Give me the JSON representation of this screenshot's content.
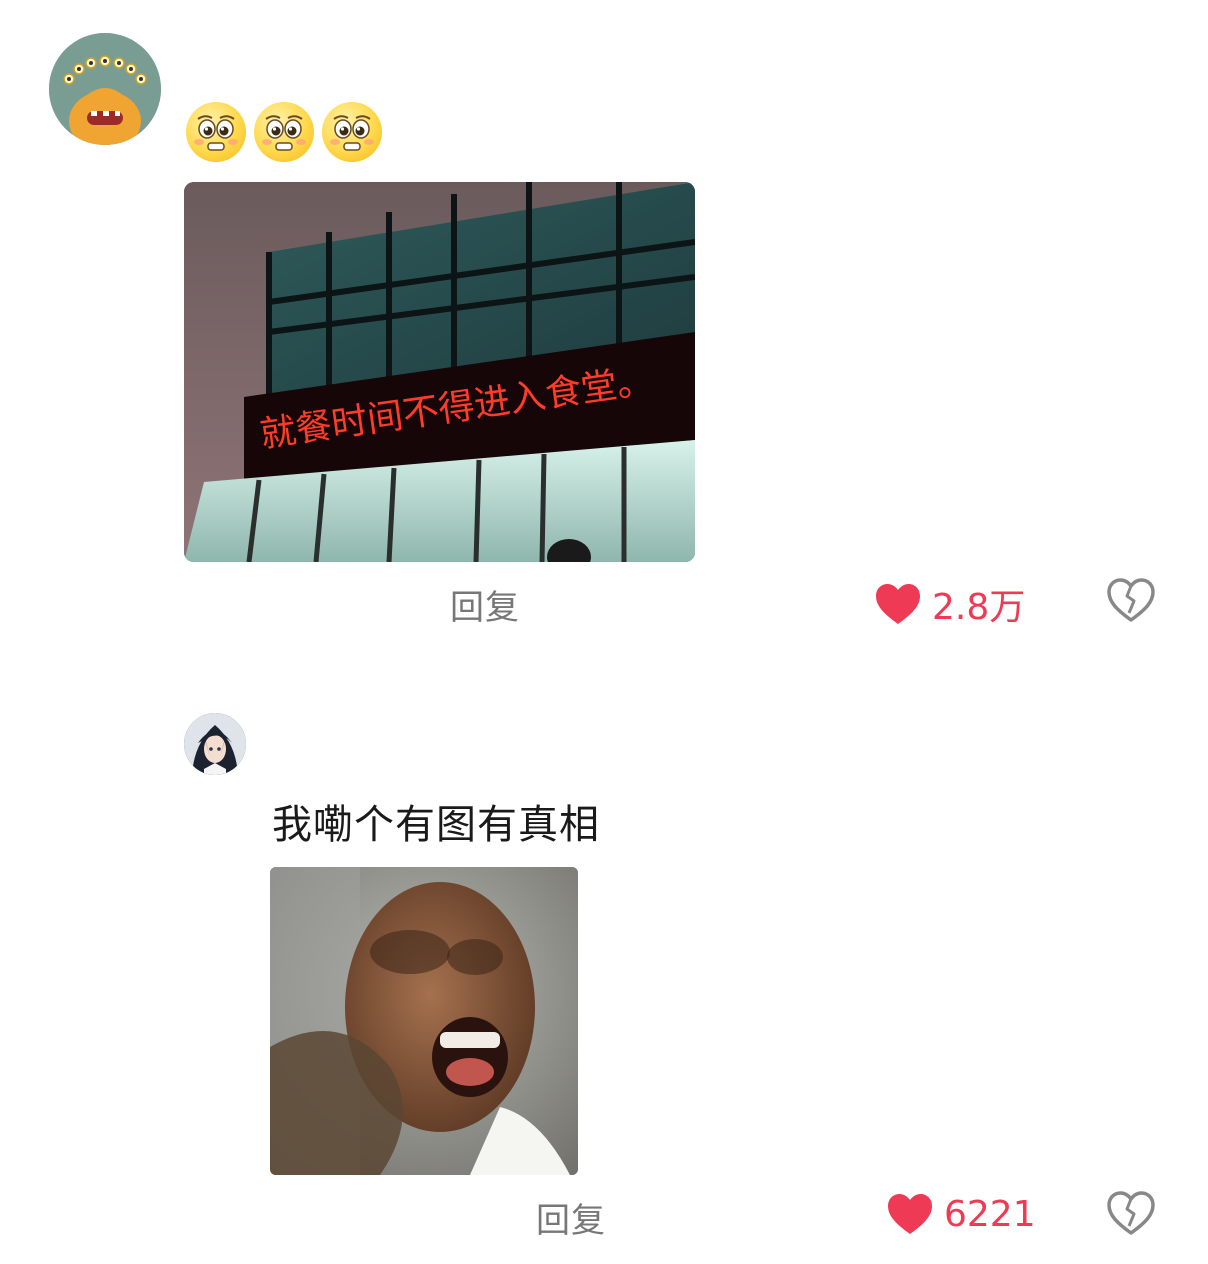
{
  "comments": [
    {
      "emojis": [
        "pleading-face-emoji",
        "pleading-face-emoji",
        "pleading-face-emoji"
      ],
      "photo_sign_text": "就餐时间不得进入食堂。",
      "reply_label": "回复",
      "like_count": "2.8万"
    },
    {
      "text": "我嘞个有图有真相",
      "reply_label": "回复",
      "like_count": "6221"
    }
  ],
  "colors": {
    "like_red": "#ef3a55",
    "icon_gray": "#888888",
    "reply_gray": "#777777"
  }
}
